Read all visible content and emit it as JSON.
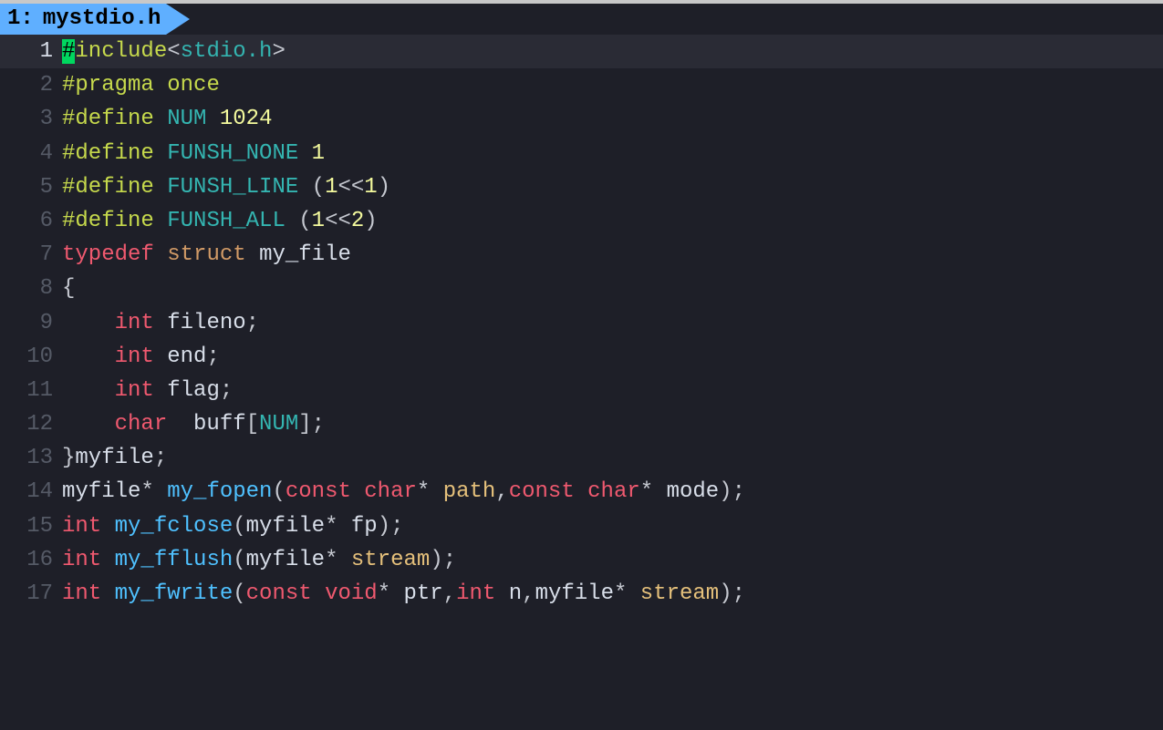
{
  "tab": {
    "index": "1:",
    "filename": "mystdio.h"
  },
  "gutter": {
    "l1": "1",
    "l2": "2",
    "l3": "3",
    "l4": "4",
    "l5": "5",
    "l6": "6",
    "l7": "7",
    "l8": "8",
    "l9": "9",
    "l10": "10",
    "l11": "11",
    "l12": "12",
    "l13": "13",
    "l14": "14",
    "l15": "15",
    "l16": "16",
    "l17": "17"
  },
  "code": {
    "l1": {
      "hash": "#",
      "include": "include",
      "open": "<",
      "hdr": "stdio.h",
      "close": ">"
    },
    "l2": {
      "pragma": "#pragma",
      "sp": " ",
      "once": "once"
    },
    "l3": {
      "define": "#define",
      "sp": " ",
      "name": "NUM",
      "sp2": " ",
      "val": "1024"
    },
    "l4": {
      "define": "#define",
      "sp": " ",
      "name": "FUNSH_NONE",
      "sp2": " ",
      "val": "1"
    },
    "l5": {
      "define": "#define",
      "sp": " ",
      "name": "FUNSH_LINE",
      "sp2": " ",
      "lp": "(",
      "n1": "1",
      "op": "<<",
      "n2": "1",
      "rp": ")"
    },
    "l6": {
      "define": "#define",
      "sp": " ",
      "name": "FUNSH_ALL",
      "sp2": " ",
      "lp": "(",
      "n1": "1",
      "op": "<<",
      "n2": "2",
      "rp": ")"
    },
    "l7": {
      "typedef": "typedef",
      "sp": " ",
      "struct": "struct",
      "sp2": " ",
      "name": "my_file"
    },
    "l8": {
      "brace": "{"
    },
    "l9": {
      "indent": "    ",
      "type": "int",
      "sp": " ",
      "name": "fileno",
      "semi": ";"
    },
    "l10": {
      "indent": "    ",
      "type": "int",
      "sp": " ",
      "name": "end",
      "semi": ";"
    },
    "l11": {
      "indent": "    ",
      "type": "int",
      "sp": " ",
      "name": "flag",
      "semi": ";"
    },
    "l12": {
      "indent": "    ",
      "type": "char",
      "sp": "  ",
      "name": "buff",
      "lb": "[",
      "sz": "NUM",
      "rb": "]",
      "semi": ";"
    },
    "l13": {
      "brace": "}",
      "name": "myfile",
      "semi": ";"
    },
    "l14": {
      "ret": "myfile",
      "star": "*",
      "sp": " ",
      "fn": "my_fopen",
      "lp": "(",
      "c1": "const",
      "sp1": " ",
      "t1": "char",
      "s1": "*",
      "sp2": " ",
      "p1": "path",
      "comma": ",",
      "c2": "const",
      "sp3": " ",
      "t2": "char",
      "s2": "*",
      "sp4": " ",
      "p2": "mode",
      "rp": ")",
      "semi": ";"
    },
    "l15": {
      "ret": "int",
      "sp": " ",
      "fn": "my_fclose",
      "lp": "(",
      "t1": "myfile",
      "s1": "*",
      "sp1": " ",
      "p1": "fp",
      "rp": ")",
      "semi": ";"
    },
    "l16": {
      "ret": "int",
      "sp": " ",
      "fn": "my_fflush",
      "lp": "(",
      "t1": "myfile",
      "s1": "*",
      "sp1": " ",
      "p1": "stream",
      "rp": ")",
      "semi": ";"
    },
    "l17": {
      "ret": "int",
      "sp": " ",
      "fn": "my_fwrite",
      "lp": "(",
      "c1": "const",
      "sp1": " ",
      "t1": "void",
      "s1": "*",
      "sp2": " ",
      "p1": "ptr",
      "comma1": ",",
      "t2": "int",
      "sp3": " ",
      "p2": "n",
      "comma2": ",",
      "t3": "myfile",
      "s3": "*",
      "sp4": " ",
      "p3": "stream",
      "rp": ")",
      "semi": ";"
    }
  }
}
